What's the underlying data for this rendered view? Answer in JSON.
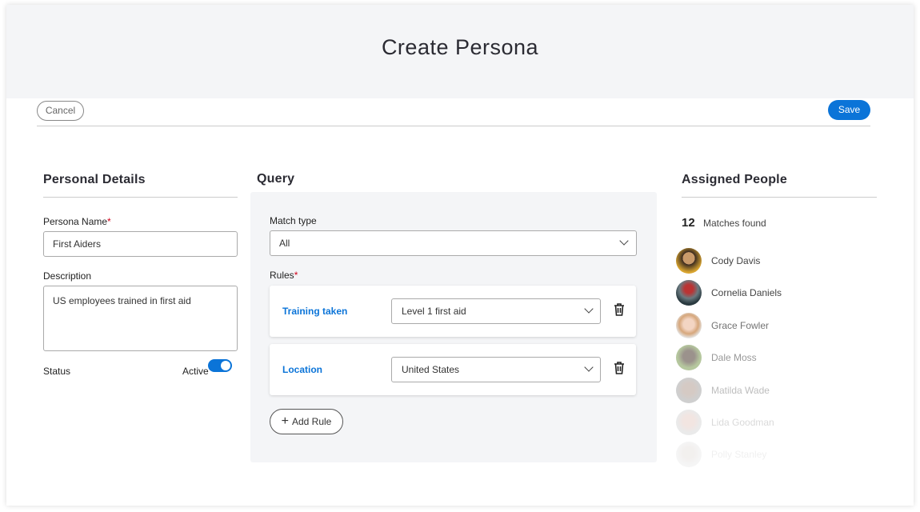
{
  "header": {
    "title": "Create Persona"
  },
  "toolbar": {
    "cancel_label": "Cancel",
    "save_label": "Save"
  },
  "personal": {
    "heading": "Personal Details",
    "name_label": "Persona Name",
    "name_value": "First Aiders",
    "description_label": "Description",
    "description_value": "US employees trained in first aid",
    "status_label": "Status",
    "status_value": "Active",
    "status_on": true
  },
  "query": {
    "heading": "Query",
    "match_label": "Match type",
    "match_value": "All",
    "rules_label": "Rules",
    "rules": [
      {
        "field": "Training taken",
        "value": "Level 1 first aid"
      },
      {
        "field": "Location",
        "value": "United States"
      }
    ],
    "add_rule_label": "Add Rule"
  },
  "assigned": {
    "heading": "Assigned People",
    "count": "12",
    "count_label": "Matches found",
    "people": [
      {
        "name": "Cody Davis"
      },
      {
        "name": "Cornelia Daniels"
      },
      {
        "name": "Grace Fowler"
      },
      {
        "name": "Dale Moss"
      },
      {
        "name": "Matilda Wade"
      },
      {
        "name": "Lida Goodman"
      },
      {
        "name": "Polly Stanley"
      }
    ]
  },
  "colors": {
    "accent": "#0b74d8",
    "required": "#d0021b",
    "panel": "#f4f5f7"
  }
}
